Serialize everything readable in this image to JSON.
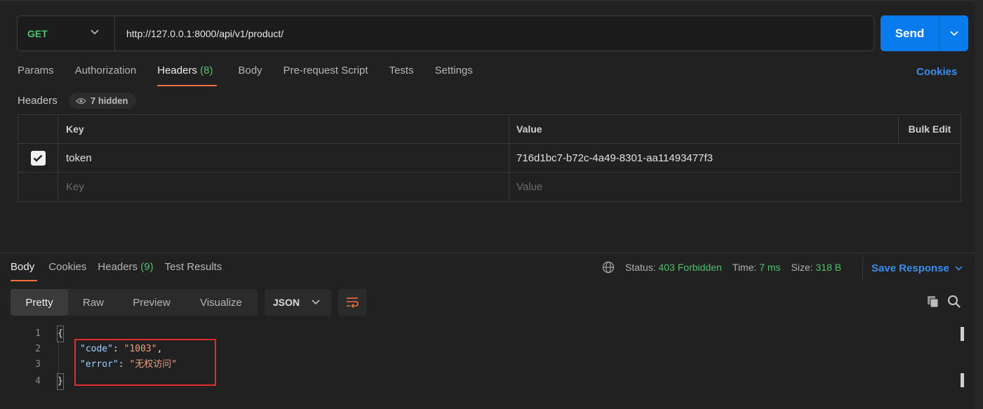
{
  "request": {
    "method": "GET",
    "url": "http://127.0.0.1:8000/api/v1/product/",
    "send_label": "Send"
  },
  "request_tabs": [
    {
      "label": "Params"
    },
    {
      "label": "Authorization"
    },
    {
      "label": "Headers",
      "count": "(8)"
    },
    {
      "label": "Body"
    },
    {
      "label": "Pre-request Script"
    },
    {
      "label": "Tests"
    },
    {
      "label": "Settings"
    }
  ],
  "cookies_link": "Cookies",
  "headers_section": {
    "title": "Headers",
    "hidden_label": "7 hidden",
    "columns": {
      "key": "Key",
      "value": "Value",
      "bulk_edit": "Bulk Edit"
    },
    "rows": [
      {
        "checked": true,
        "key": "token",
        "value": "716d1bc7-b72c-4a49-8301-aa11493477f3"
      }
    ],
    "placeholder": {
      "key": "Key",
      "value": "Value"
    }
  },
  "response_tabs": [
    {
      "label": "Body"
    },
    {
      "label": "Cookies"
    },
    {
      "label": "Headers",
      "count": "(9)"
    },
    {
      "label": "Test Results"
    }
  ],
  "response_status": {
    "status_label": "Status:",
    "status_value": "403 Forbidden",
    "time_label": "Time:",
    "time_value": "7 ms",
    "size_label": "Size:",
    "size_value": "318 B",
    "save_response": "Save Response"
  },
  "view_modes": [
    "Pretty",
    "Raw",
    "Preview",
    "Visualize"
  ],
  "format": "JSON",
  "code_lines": [
    {
      "n": "1",
      "text": "{"
    },
    {
      "n": "2",
      "key": "\"code\"",
      "sep": ": ",
      "val": "\"1003\"",
      "tail": ","
    },
    {
      "n": "3",
      "key": "\"error\"",
      "sep": ": ",
      "val": "\"无权访问\"",
      "tail": ""
    },
    {
      "n": "4",
      "text": "}"
    }
  ],
  "colors": {
    "accent_orange": "#f26b3a",
    "status_green": "#4fc26c",
    "link_blue": "#3b8ded",
    "send_blue": "#097bed",
    "highlight_red": "#e02d2d"
  },
  "icons": [
    "chevron-down-icon",
    "eye-icon",
    "check-icon",
    "globe-icon",
    "wrap-icon",
    "copy-icon",
    "search-icon"
  ]
}
